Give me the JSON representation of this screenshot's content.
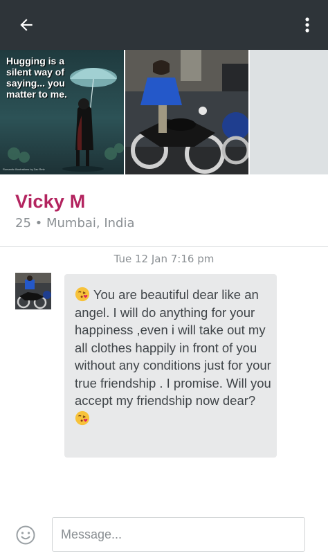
{
  "topbar": {
    "back_icon": "arrow-left-icon",
    "menu_icon": "more-vertical-icon",
    "background": "#2e3439"
  },
  "photos": {
    "photo1_text": "Hugging is a silent way of saying... you matter to me.",
    "photo1_credit": "Romantic Illustrations by Zac Retz"
  },
  "profile": {
    "name": "Vicky M",
    "age_location": "25 • Mumbai, India",
    "accent_color": "#b3245f"
  },
  "chat": {
    "timestamp": "Tue 12 Jan 7:16 pm",
    "message": {
      "emoji_icon": "kissing-heart-emoji-icon",
      "text": "You are beautiful dear like an angel. I will do anything for your happiness ,even i will take out my all clothes happily in front of you without any conditions just for your true friendship . I promise. Will you accept my friendship now dear?"
    }
  },
  "composer": {
    "smiley_icon": "smiley-icon",
    "placeholder": "Message..."
  }
}
